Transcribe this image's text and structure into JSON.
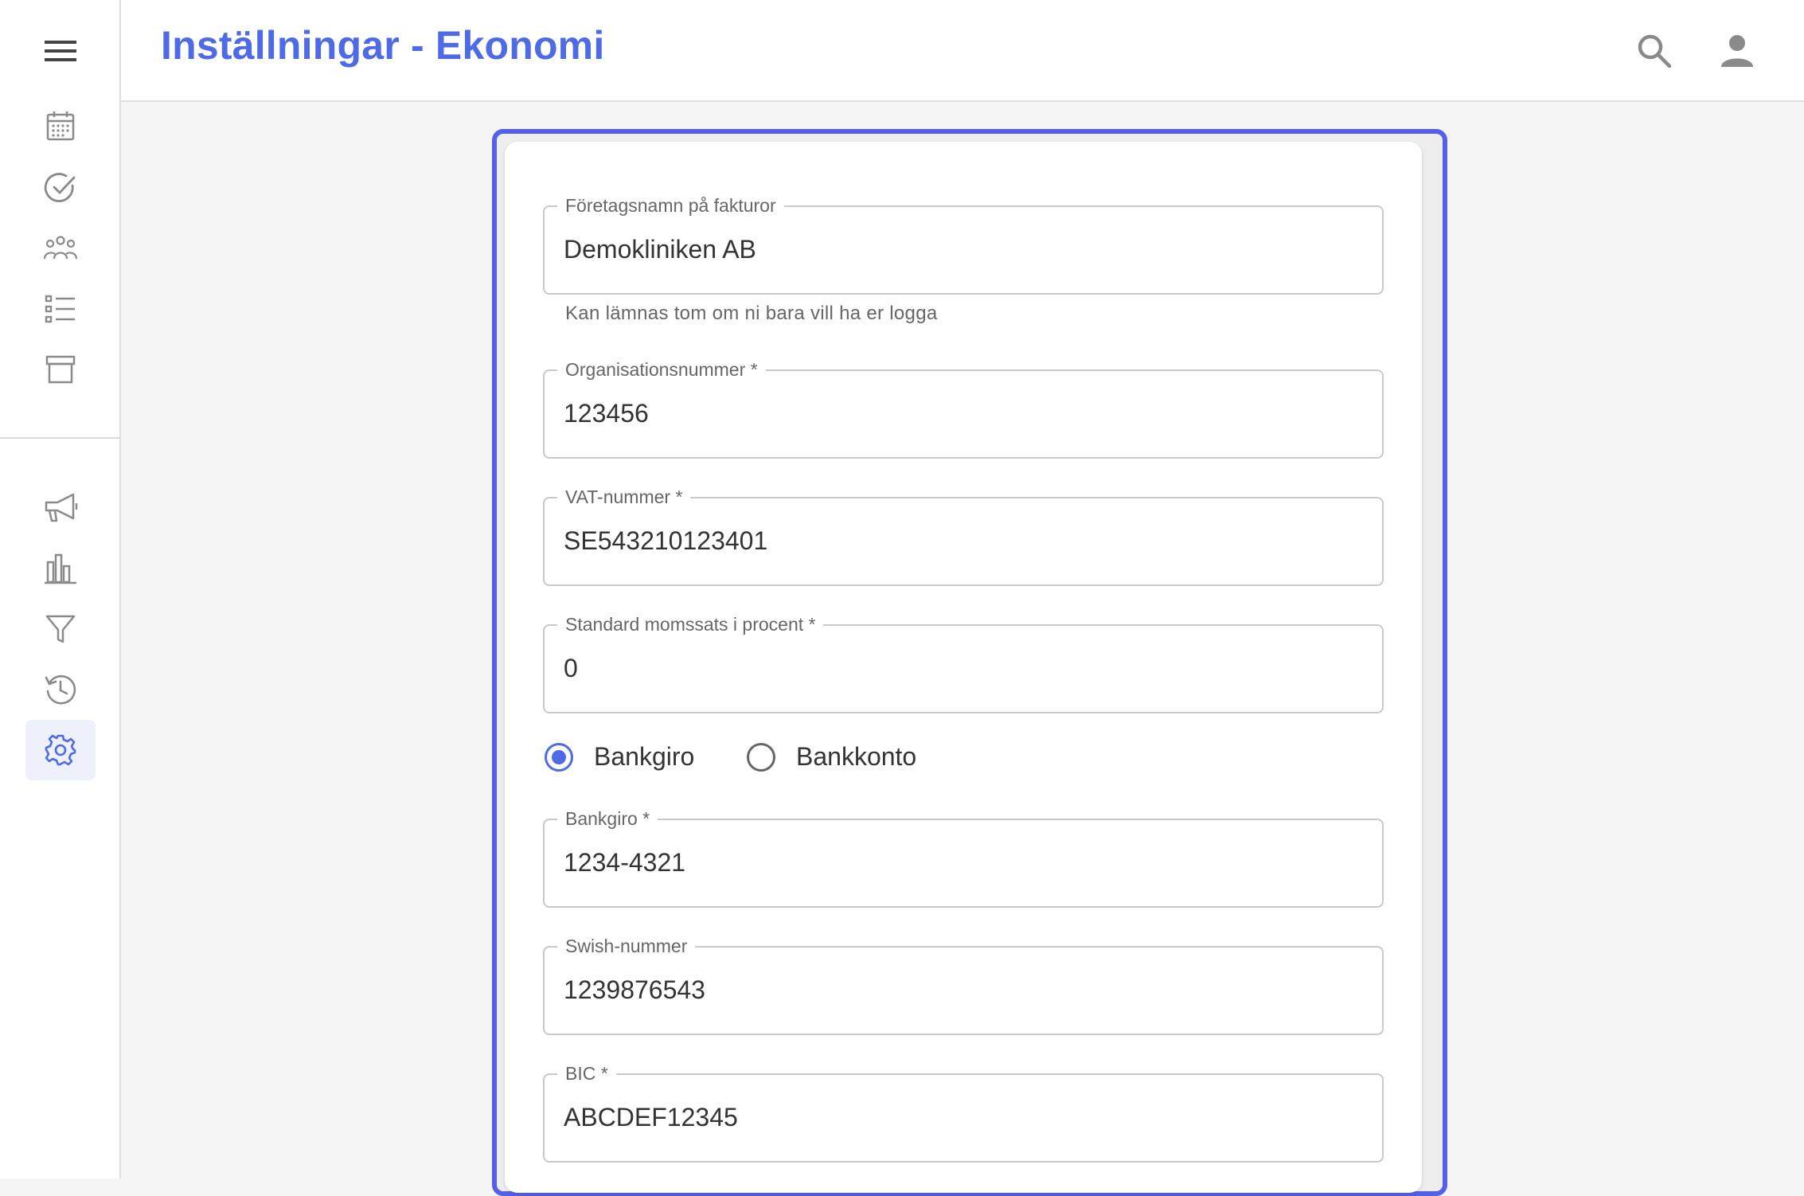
{
  "header": {
    "title": "Inställningar - Ekonomi"
  },
  "icons": {
    "menu": "menu-icon",
    "search": "search-icon",
    "account": "account-icon",
    "calendar": "calendar-icon",
    "tasks": "check-circle-icon",
    "patients": "group-icon",
    "list": "list-icon",
    "archive": "archive-icon",
    "marketing": "megaphone-icon",
    "statistics": "bar-chart-icon",
    "filter": "filter-icon",
    "history": "history-icon",
    "settings": "gear-icon"
  },
  "colors": {
    "accent": "#4f6ae6",
    "frame": "#5560e6"
  },
  "form": {
    "company_name": {
      "label": "Företagsnamn på fakturor",
      "value": "Demokliniken AB",
      "helper": "Kan lämnas tom om ni bara vill ha er logga"
    },
    "org_number": {
      "label": "Organisationsnummer *",
      "value": "123456"
    },
    "vat_number": {
      "label": "VAT-nummer *",
      "value": "SE543210123401"
    },
    "vat_rate": {
      "label": "Standard momssats i procent *",
      "value": "0"
    },
    "payment_type": {
      "options": [
        "Bankgiro",
        "Bankkonto"
      ],
      "selected": "Bankgiro"
    },
    "bankgiro": {
      "label": "Bankgiro *",
      "value": "1234-4321"
    },
    "swish": {
      "label": "Swish-nummer",
      "value": "1239876543"
    },
    "bic": {
      "label": "BIC *",
      "value": "ABCDEF12345"
    }
  }
}
